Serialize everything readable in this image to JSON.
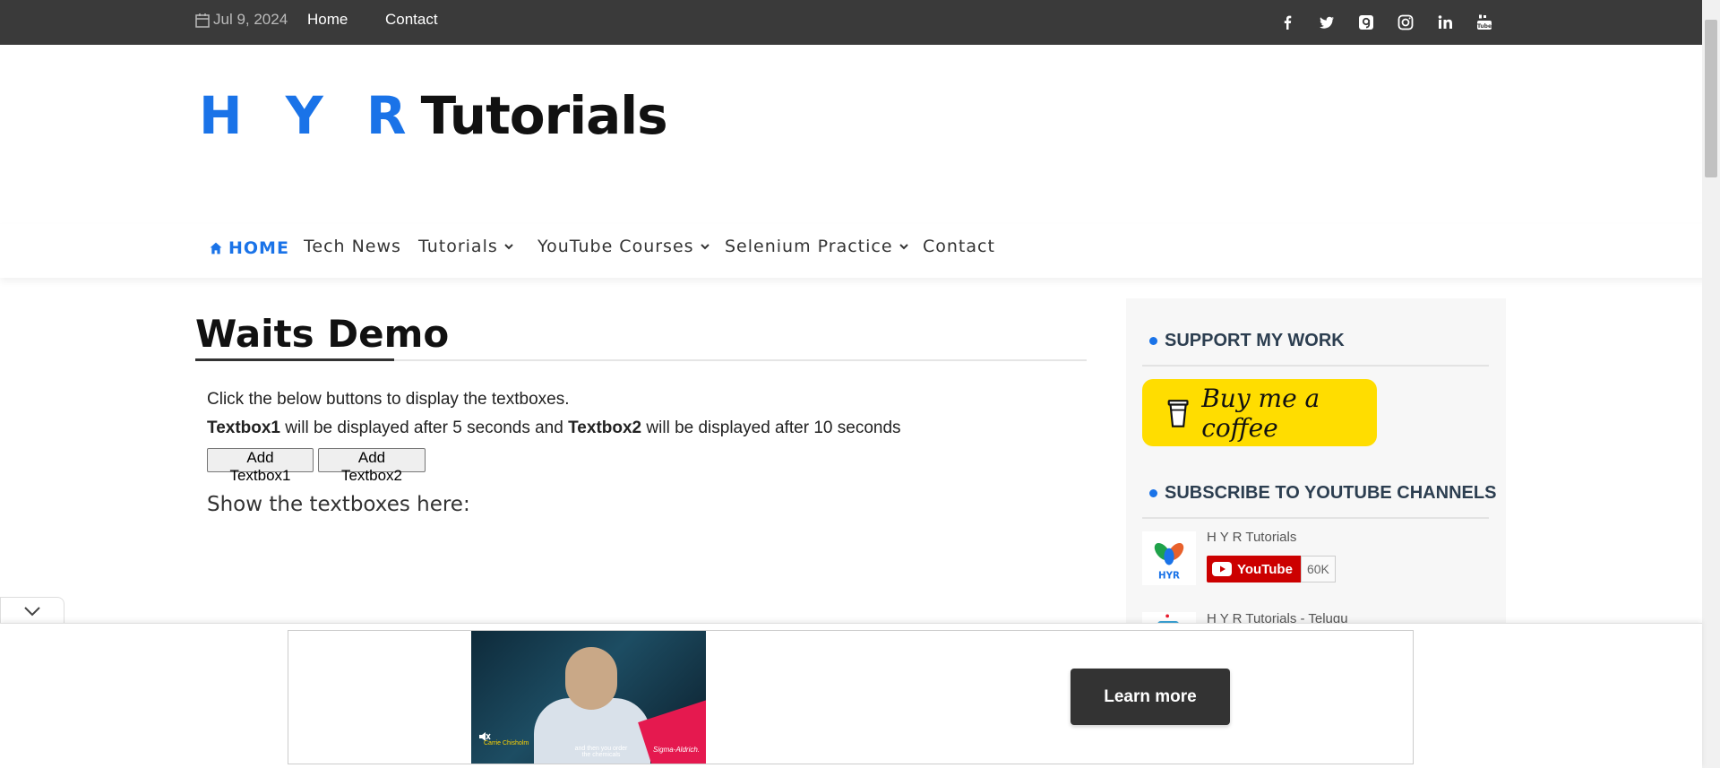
{
  "topbar": {
    "date": "Jul 9, 2024",
    "links": [
      "Home",
      "Contact"
    ],
    "social_icons": [
      "facebook-icon",
      "twitter-icon",
      "goodreads-icon",
      "instagram-icon",
      "linkedin-icon",
      "youtube-icon"
    ]
  },
  "header": {
    "logo_part1": "H Y R",
    "logo_part2": "Tutorials",
    "brand_color": "#1a73e8"
  },
  "nav": {
    "items": [
      {
        "label": "HOME",
        "icon": "home-icon",
        "active": true
      },
      {
        "label": "Tech News"
      },
      {
        "label": "Tutorials",
        "dropdown": true
      },
      {
        "label": "YouTube Courses",
        "dropdown": true
      },
      {
        "label": "Selenium Practice",
        "dropdown": true
      },
      {
        "label": "Contact"
      }
    ]
  },
  "main": {
    "title": "Waits Demo",
    "instruction": "Click the below buttons to display the textboxes.",
    "detail": {
      "bold1": "Textbox1",
      "mid": " will be displayed after 5 seconds and ",
      "bold2": "Textbox2",
      "end": " will be displayed after 10 seconds"
    },
    "button1": "Add Textbox1",
    "button2": "Add Textbox2",
    "show_label": "Show the textboxes here:"
  },
  "sidebar": {
    "support_title": "SUPPORT MY WORK",
    "coffee_label": "Buy me a coffee",
    "subscribe_title": "SUBSCRIBE TO YOUTUBE CHANNELS",
    "channels": [
      {
        "name": "H Y R Tutorials",
        "youtube_label": "YouTube",
        "count": "60K",
        "logo_text": "HYR"
      },
      {
        "name": "H Y R Tutorials - Telugu"
      }
    ]
  },
  "ad": {
    "cta": "Learn more",
    "caption": "and then you order the chemicals",
    "speaker": "Carrie Chisholm",
    "brand": "Sigma-Aldrich."
  }
}
